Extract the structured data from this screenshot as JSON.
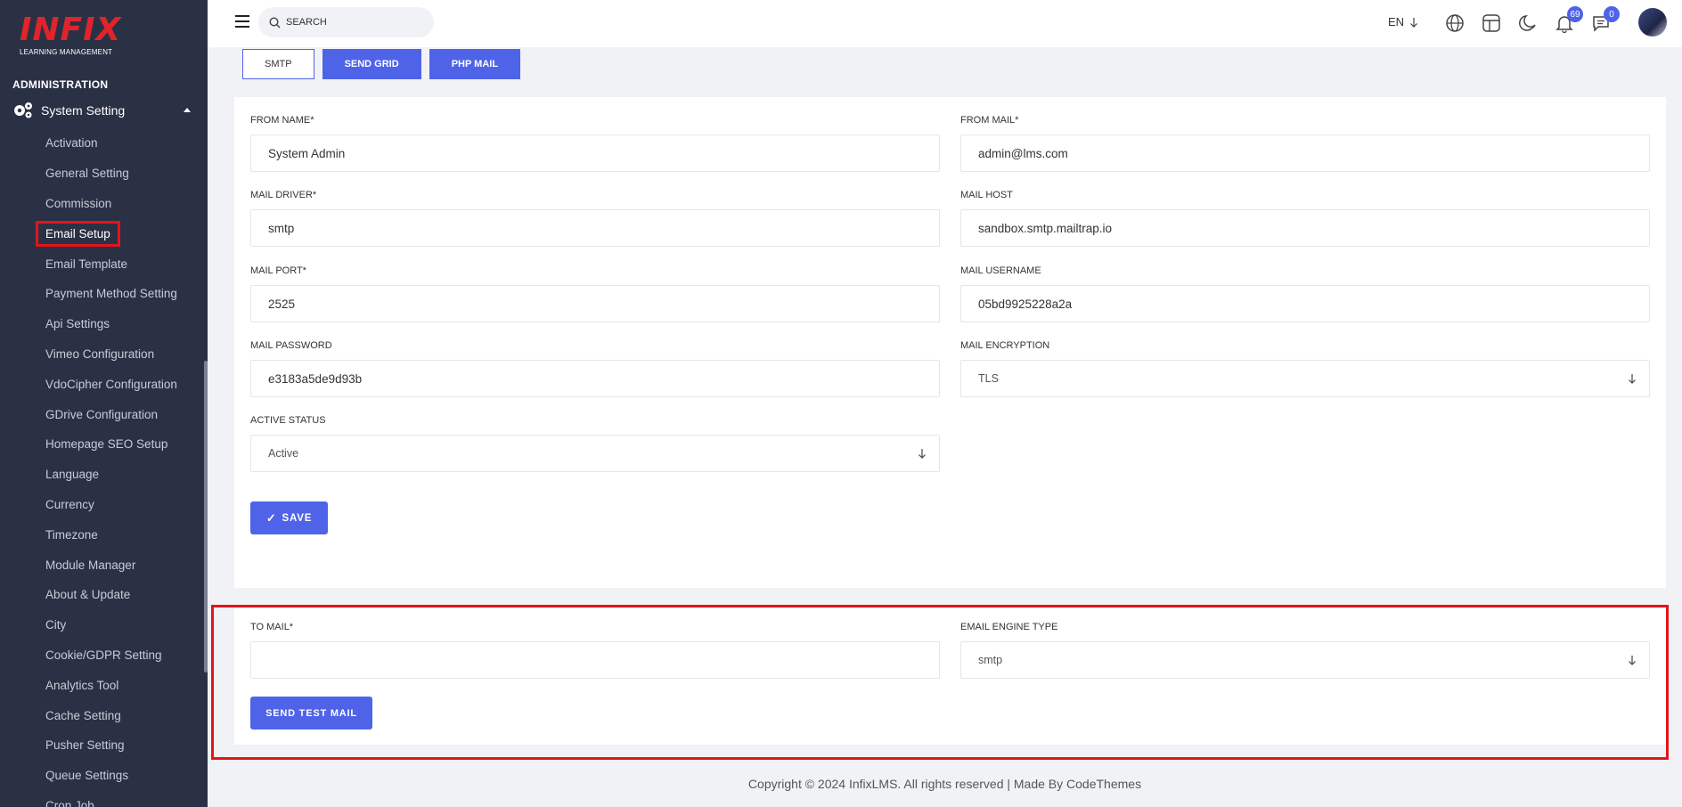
{
  "brand": {
    "logo_main": "INFIX",
    "logo_sub": "LEARNING MANAGEMENT"
  },
  "sidebar": {
    "section": "ADMINISTRATION",
    "parent": "System Setting",
    "items": [
      {
        "label": "Activation"
      },
      {
        "label": "General Setting"
      },
      {
        "label": "Commission"
      },
      {
        "label": "Email Setup"
      },
      {
        "label": "Email Template"
      },
      {
        "label": "Payment Method Setting"
      },
      {
        "label": "Api Settings"
      },
      {
        "label": "Vimeo Configuration"
      },
      {
        "label": "VdoCipher Configuration"
      },
      {
        "label": "GDrive Configuration"
      },
      {
        "label": "Homepage SEO Setup"
      },
      {
        "label": "Language"
      },
      {
        "label": "Currency"
      },
      {
        "label": "Timezone"
      },
      {
        "label": "Module Manager"
      },
      {
        "label": "About & Update"
      },
      {
        "label": "City"
      },
      {
        "label": "Cookie/GDPR Setting"
      },
      {
        "label": "Analytics Tool"
      },
      {
        "label": "Cache Setting"
      },
      {
        "label": "Pusher Setting"
      },
      {
        "label": "Queue Settings"
      },
      {
        "label": "Cron Job"
      }
    ],
    "active_item": "Email Setup"
  },
  "topbar": {
    "search_placeholder": "SEARCH",
    "language": "EN",
    "notifications_count": "69",
    "messages_count": "0",
    "accent": "#4f63e8"
  },
  "tabs": [
    {
      "label": "SMTP"
    },
    {
      "label": "SEND GRID"
    },
    {
      "label": "PHP MAIL"
    }
  ],
  "form": {
    "from_name": {
      "label": "FROM NAME*",
      "value": "System Admin"
    },
    "from_mail": {
      "label": "FROM MAIL*",
      "value": "admin@lms.com"
    },
    "mail_driver": {
      "label": "MAIL DRIVER*",
      "value": "smtp"
    },
    "mail_host": {
      "label": "MAIL HOST",
      "value": "sandbox.smtp.mailtrap.io"
    },
    "mail_port": {
      "label": "MAIL PORT*",
      "value": "2525"
    },
    "mail_username": {
      "label": "MAIL USERNAME",
      "value": "05bd9925228a2a"
    },
    "mail_password": {
      "label": "MAIL PASSWORD",
      "value": "e3183a5de9d93b"
    },
    "mail_encryption": {
      "label": "MAIL ENCRYPTION",
      "value": "TLS"
    },
    "active_status": {
      "label": "ACTIVE STATUS",
      "value": "Active"
    },
    "save_label": "SAVE"
  },
  "test_mail": {
    "to_mail": {
      "label": "TO MAIL*",
      "value": ""
    },
    "engine_type": {
      "label": "EMAIL ENGINE TYPE",
      "value": "smtp"
    },
    "send_label": "SEND TEST MAIL"
  },
  "footer": {
    "text": "Copyright © 2024 InfixLMS. All rights reserved | Made By CodeThemes"
  }
}
